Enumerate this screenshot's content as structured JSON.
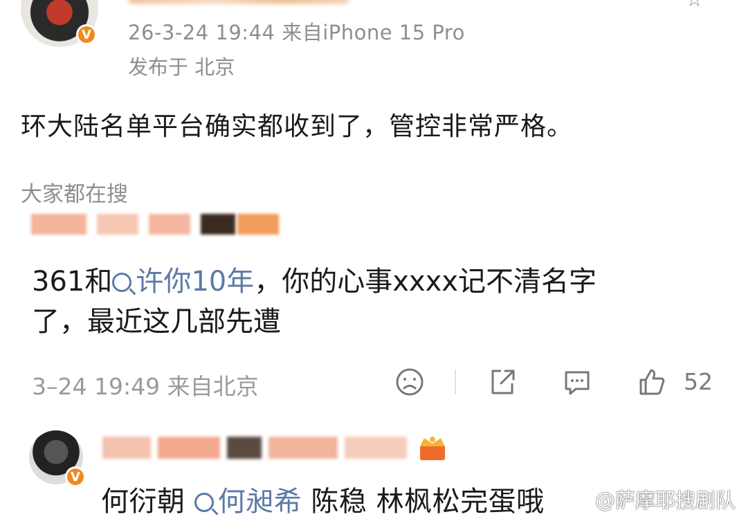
{
  "post": {
    "meta": "26-3-24 19:44  来自iPhone 15 Pro",
    "ip": "发布于 北京",
    "text": "环大陆名单平台确实都收到了，管控非常严格。"
  },
  "search": {
    "label": "大家都在搜"
  },
  "comment": {
    "prefix": "361和",
    "link": "许你10年",
    "rest1": "，你的心事xxxx记不清名字",
    "line2": "了，最近这几部先遭",
    "meta": "3–24 19:49  来自北京",
    "like_count": "52"
  },
  "reply": {
    "prefix": "何衍朝 ",
    "link": "何昶希",
    "rest": " 陈稳 林枫松完蛋哦"
  },
  "watermark": "@萨摩耶搜剧队",
  "colors": {
    "link": "#5b7aa6",
    "meta_gray": "#8e8e8e",
    "verified_badge": "#f08a1c"
  },
  "icons": [
    "star-icon",
    "verified-badge-icon",
    "search-icon",
    "dislike-face-icon",
    "share-icon",
    "comment-icon",
    "like-icon",
    "crown-icon"
  ]
}
